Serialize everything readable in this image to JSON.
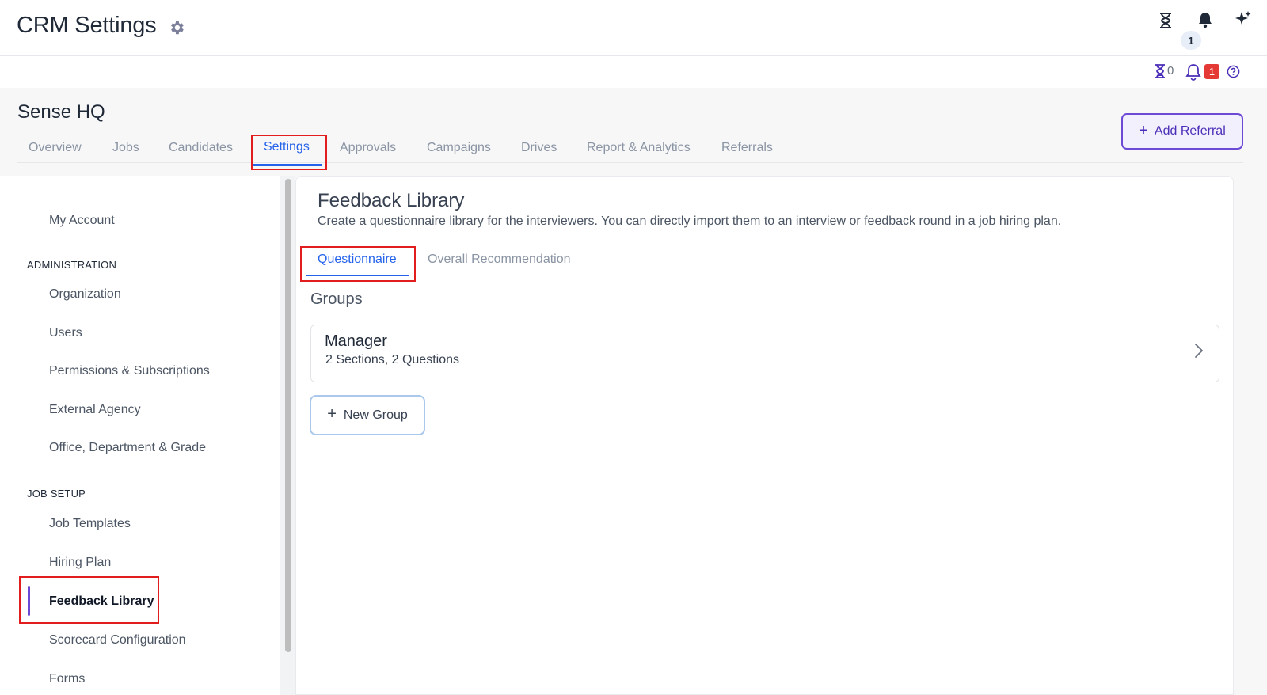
{
  "header": {
    "app_title": "CRM Settings",
    "notification_count": "1",
    "icons": [
      "gear-icon",
      "hourglass-icon",
      "bell-icon",
      "sparkle-icon"
    ]
  },
  "strip": {
    "pending_count": "0",
    "alert_badge": "1",
    "icons": [
      "hourglass-icon",
      "bell-icon",
      "help-icon"
    ]
  },
  "org": {
    "name": "Sense HQ"
  },
  "nav_tabs": [
    {
      "label": "Overview"
    },
    {
      "label": "Jobs"
    },
    {
      "label": "Candidates"
    },
    {
      "label": "Settings",
      "active": true
    },
    {
      "label": "Approvals"
    },
    {
      "label": "Campaigns"
    },
    {
      "label": "Drives"
    },
    {
      "label": "Report & Analytics"
    },
    {
      "label": "Referrals"
    }
  ],
  "add_referral": {
    "label": "Add Referral",
    "icon": "plus-icon"
  },
  "sidebar": {
    "my_account": "My Account",
    "administration_heading": "ADMINISTRATION",
    "administration": [
      "Organization",
      "Users",
      "Permissions & Subscriptions",
      "External Agency",
      "Office, Department & Grade"
    ],
    "job_setup_heading": "JOB SETUP",
    "job_setup": [
      "Job Templates",
      "Hiring Plan",
      "Feedback Library",
      "Scorecard Configuration",
      "Forms"
    ],
    "active_item": "Feedback Library"
  },
  "main": {
    "title": "Feedback Library",
    "description": "Create a questionnaire library for the interviewers. You can directly import them to an interview or feedback round in a job hiring plan.",
    "subtabs": [
      {
        "label": "Questionnaire",
        "active": true
      },
      {
        "label": "Overall Recommendation"
      }
    ],
    "groups_heading": "Groups",
    "groups": [
      {
        "name": "Manager",
        "meta": "2 Sections, 2 Questions"
      }
    ],
    "new_group_label": "New Group"
  },
  "colors": {
    "accent_blue": "#2563eb",
    "accent_purple": "#6d4ad6",
    "highlight_red": "#e11d1d",
    "badge_red": "#e53935"
  }
}
